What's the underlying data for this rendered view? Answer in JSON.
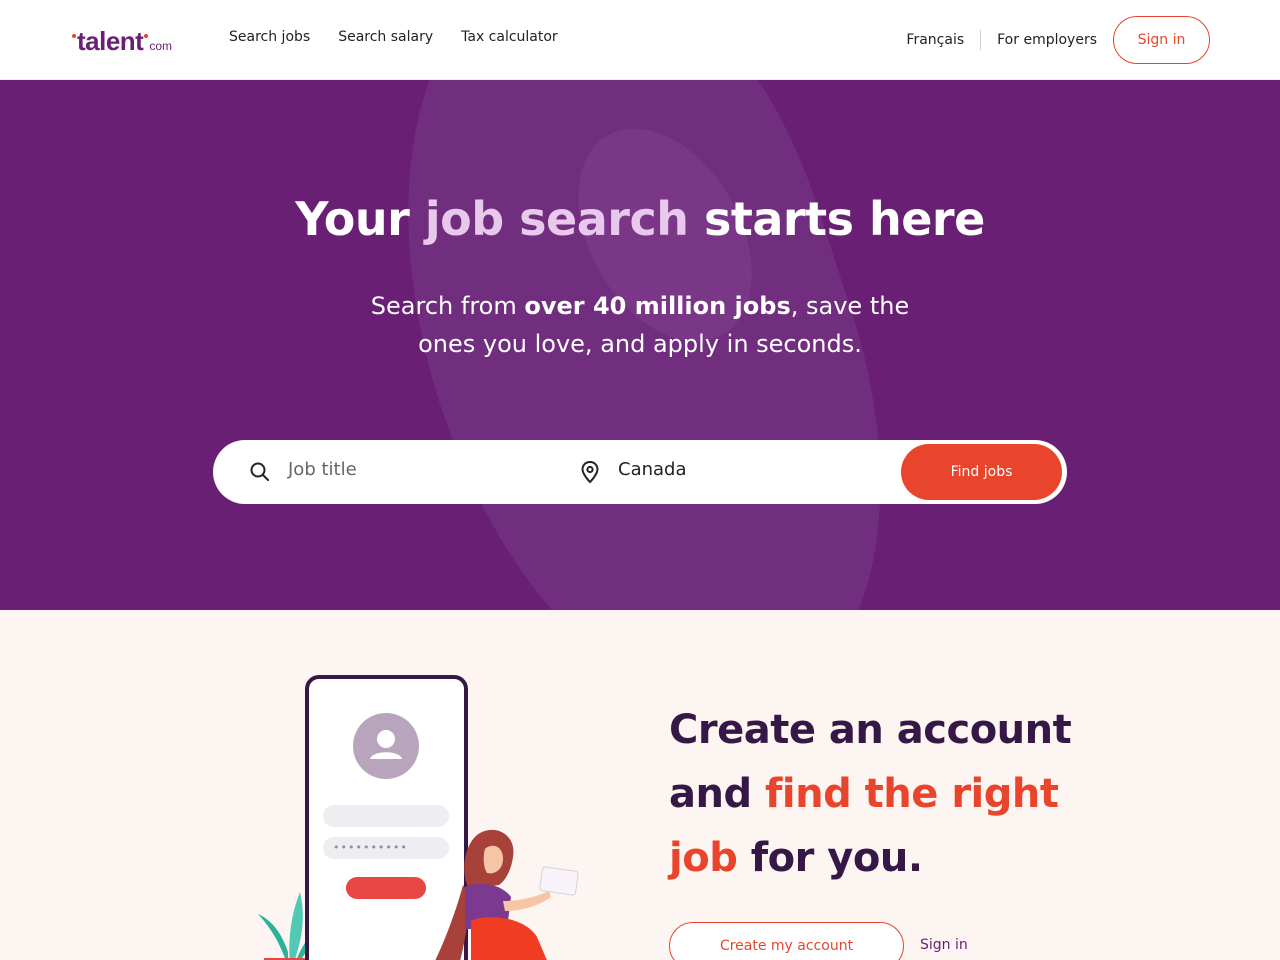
{
  "header": {
    "logo_main": "talent",
    "logo_suffix": "com",
    "nav": [
      "Search jobs",
      "Search salary",
      "Tax calculator"
    ],
    "language": "Français",
    "employers": "For employers",
    "signin": "Sign in"
  },
  "hero": {
    "title_pre": "Your ",
    "title_highlight": "job search",
    "title_post": " starts here",
    "sub_pre": "Search from ",
    "sub_bold": "over 40 million jobs",
    "sub_post": ", save the ones you love, and apply in seconds."
  },
  "search": {
    "job_placeholder": "Job title",
    "location_value": "Canada",
    "find_label": "Find jobs"
  },
  "cta": {
    "line1": "Create an account",
    "and": "and ",
    "find_right": "find the right",
    "job": "job",
    "for_you": " for you.",
    "create_label": "Create my account",
    "signin_label": "Sign in"
  },
  "illustration": {
    "password_dots": "••••••••••"
  },
  "colors": {
    "brand_purple": "#691f74",
    "accent_orange": "#e8452c",
    "highlight_lilac": "#e9c8ee",
    "dark_purple": "#361846",
    "cream": "#fdf5f1"
  }
}
